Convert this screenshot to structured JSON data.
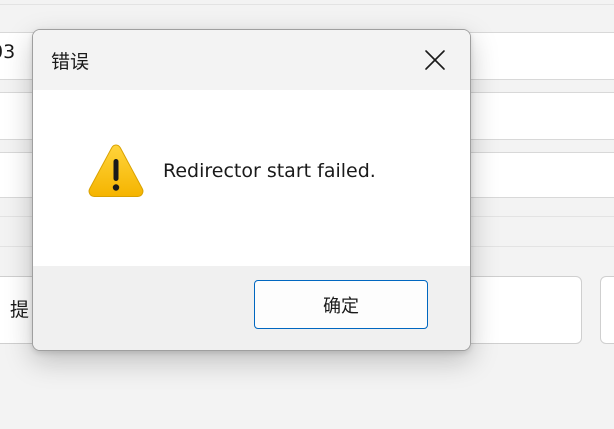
{
  "background_window": {
    "field_partial_text": "03",
    "button_partial_text": "提"
  },
  "dialog": {
    "title": "错误",
    "close_icon": "close-icon",
    "icon": "warning-icon",
    "message": "Redirector start failed.",
    "ok_button_label": "确定",
    "colors": {
      "titlebar_bg": "#f3f3f3",
      "body_bg": "#ffffff",
      "footer_bg": "#f0f0f0",
      "ok_button_border": "#0067c0",
      "warning_yellow": "#fcc419",
      "warning_dark": "#1a1a1a"
    }
  }
}
